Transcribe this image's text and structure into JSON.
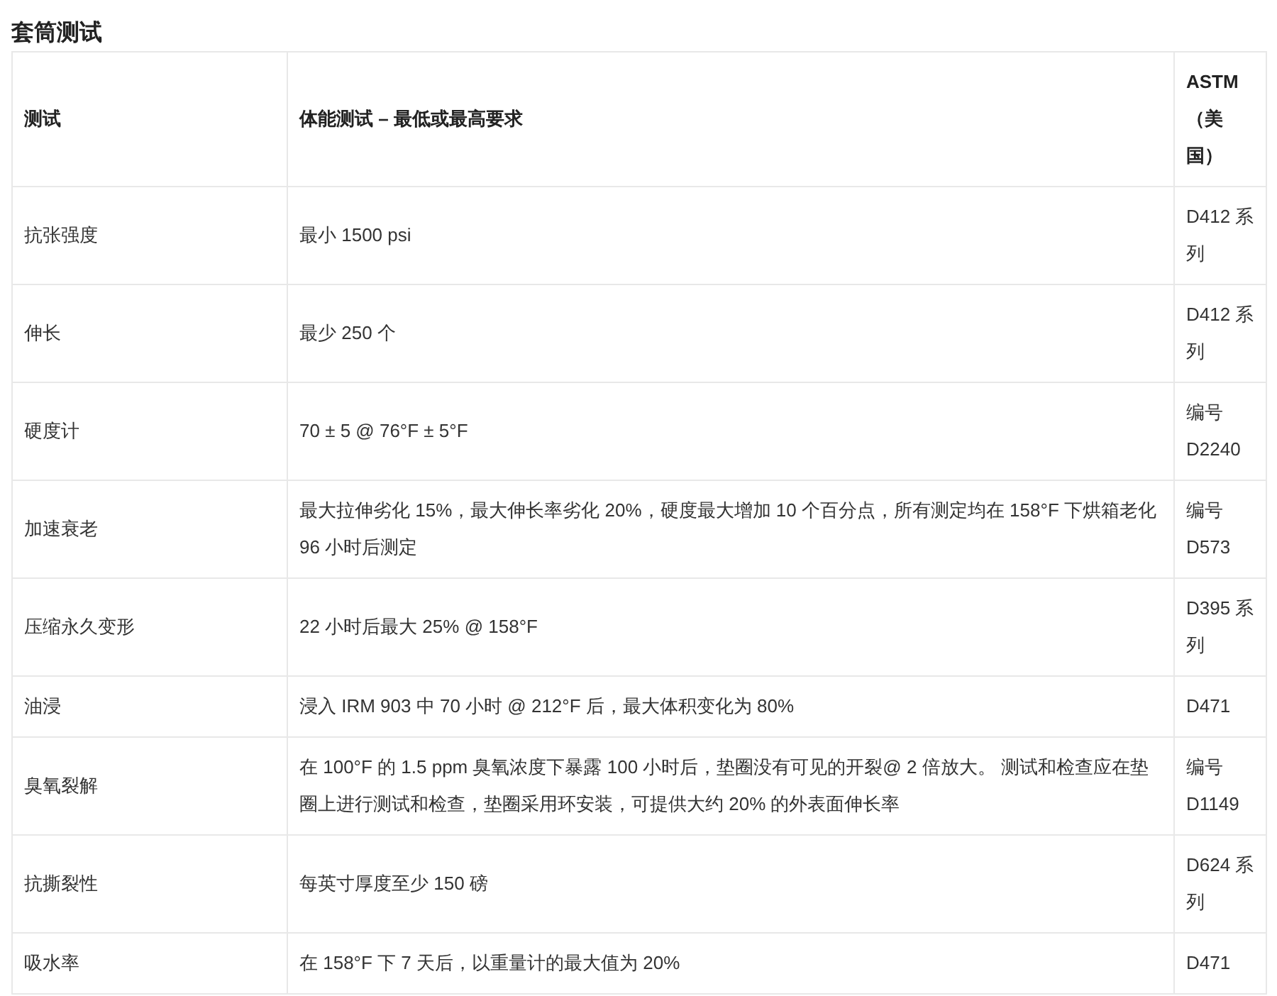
{
  "title": "套筒测试",
  "table": {
    "columns": [
      "测试",
      "体能测试 – 最低或最高要求",
      "ASTM（美国）"
    ],
    "rows": [
      [
        "抗张强度",
        "最小 1500 psi",
        "D412 系列"
      ],
      [
        "伸长",
        "最少 250 个",
        "D412 系列"
      ],
      [
        "硬度计",
        "70 ± 5 @ 76°F ± 5°F",
        "编号 D2240"
      ],
      [
        "加速衰老",
        "最大拉伸劣化 15%，最大伸长率劣化 20%，硬度最大增加 10 个百分点，所有测定均在 158°F 下烘箱老化 96 小时后测定",
        "编号 D573"
      ],
      [
        "压缩永久变形",
        "22 小时后最大 25% @ 158°F",
        "D395 系列"
      ],
      [
        "油浸",
        "浸入 IRM 903 中 70 小时 @ 212°F 后，最大体积变化为 80%",
        "D471"
      ],
      [
        "臭氧裂解",
        "在 100°F 的 1.5 ppm 臭氧浓度下暴露 100 小时后，垫圈没有可见的开裂@ 2 倍放大。 测试和检查应在垫圈上进行测试和检查，垫圈采用环安装，可提供大约 20% 的外表面伸长率",
        "编号 D1149"
      ],
      [
        "抗撕裂性",
        "每英寸厚度至少 150 磅",
        "D624 系列"
      ],
      [
        "吸水率",
        "在 158°F 下 7 天后，以重量计的最大值为 20%",
        "D471"
      ]
    ]
  }
}
